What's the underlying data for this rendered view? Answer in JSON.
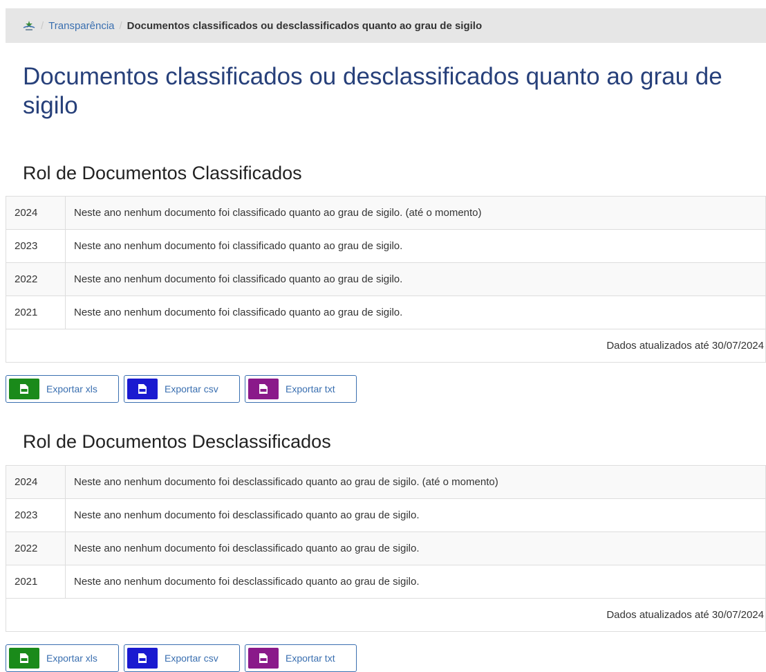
{
  "breadcrumb": {
    "home_icon": "home-logo-icon",
    "link_label": "Transparência",
    "current_label": "Documentos classificados ou desclassificados quanto ao grau de sigilo"
  },
  "page_title": "Documentos classificados ou desclassificados quanto ao grau de sigilo",
  "sections": [
    {
      "title": "Rol de Documentos Classificados",
      "rows": [
        {
          "year": "2024",
          "text": "Neste ano nenhum documento foi classificado quanto ao grau de sigilo. (até o momento)"
        },
        {
          "year": "2023",
          "text": "Neste ano nenhum documento foi classificado quanto ao grau de sigilo."
        },
        {
          "year": "2022",
          "text": "Neste ano nenhum documento foi classificado quanto ao grau de sigilo."
        },
        {
          "year": "2021",
          "text": "Neste ano nenhum documento foi classificado quanto ao grau de sigilo."
        }
      ],
      "footer": "Dados atualizados até 30/07/2024",
      "exports": [
        {
          "label": "Exportar xls",
          "icon": "xls-file-icon",
          "color": "#1a8a1a"
        },
        {
          "label": "Exportar csv",
          "icon": "csv-file-icon",
          "color": "#1a1ad0"
        },
        {
          "label": "Exportar txt",
          "icon": "txt-file-icon",
          "color": "#8a1a8a"
        }
      ]
    },
    {
      "title": "Rol de Documentos Desclassificados",
      "rows": [
        {
          "year": "2024",
          "text": "Neste ano nenhum documento foi desclassificado quanto ao grau de sigilo. (até o momento)"
        },
        {
          "year": "2023",
          "text": "Neste ano nenhum documento foi desclassificado quanto ao grau de sigilo."
        },
        {
          "year": "2022",
          "text": "Neste ano nenhum documento foi desclassificado quanto ao grau de sigilo."
        },
        {
          "year": "2021",
          "text": "Neste ano nenhum documento foi desclassificado quanto ao grau de sigilo."
        }
      ],
      "footer": "Dados atualizados até 30/07/2024",
      "exports": [
        {
          "label": "Exportar xls",
          "icon": "xls-file-icon",
          "color": "#1a8a1a"
        },
        {
          "label": "Exportar csv",
          "icon": "csv-file-icon",
          "color": "#1a1ad0"
        },
        {
          "label": "Exportar txt",
          "icon": "txt-file-icon",
          "color": "#8a1a8a"
        }
      ]
    }
  ],
  "colors": {
    "title": "#27407a",
    "link": "#3a6fb0",
    "breadcrumb_bg": "#e6e6e6"
  }
}
